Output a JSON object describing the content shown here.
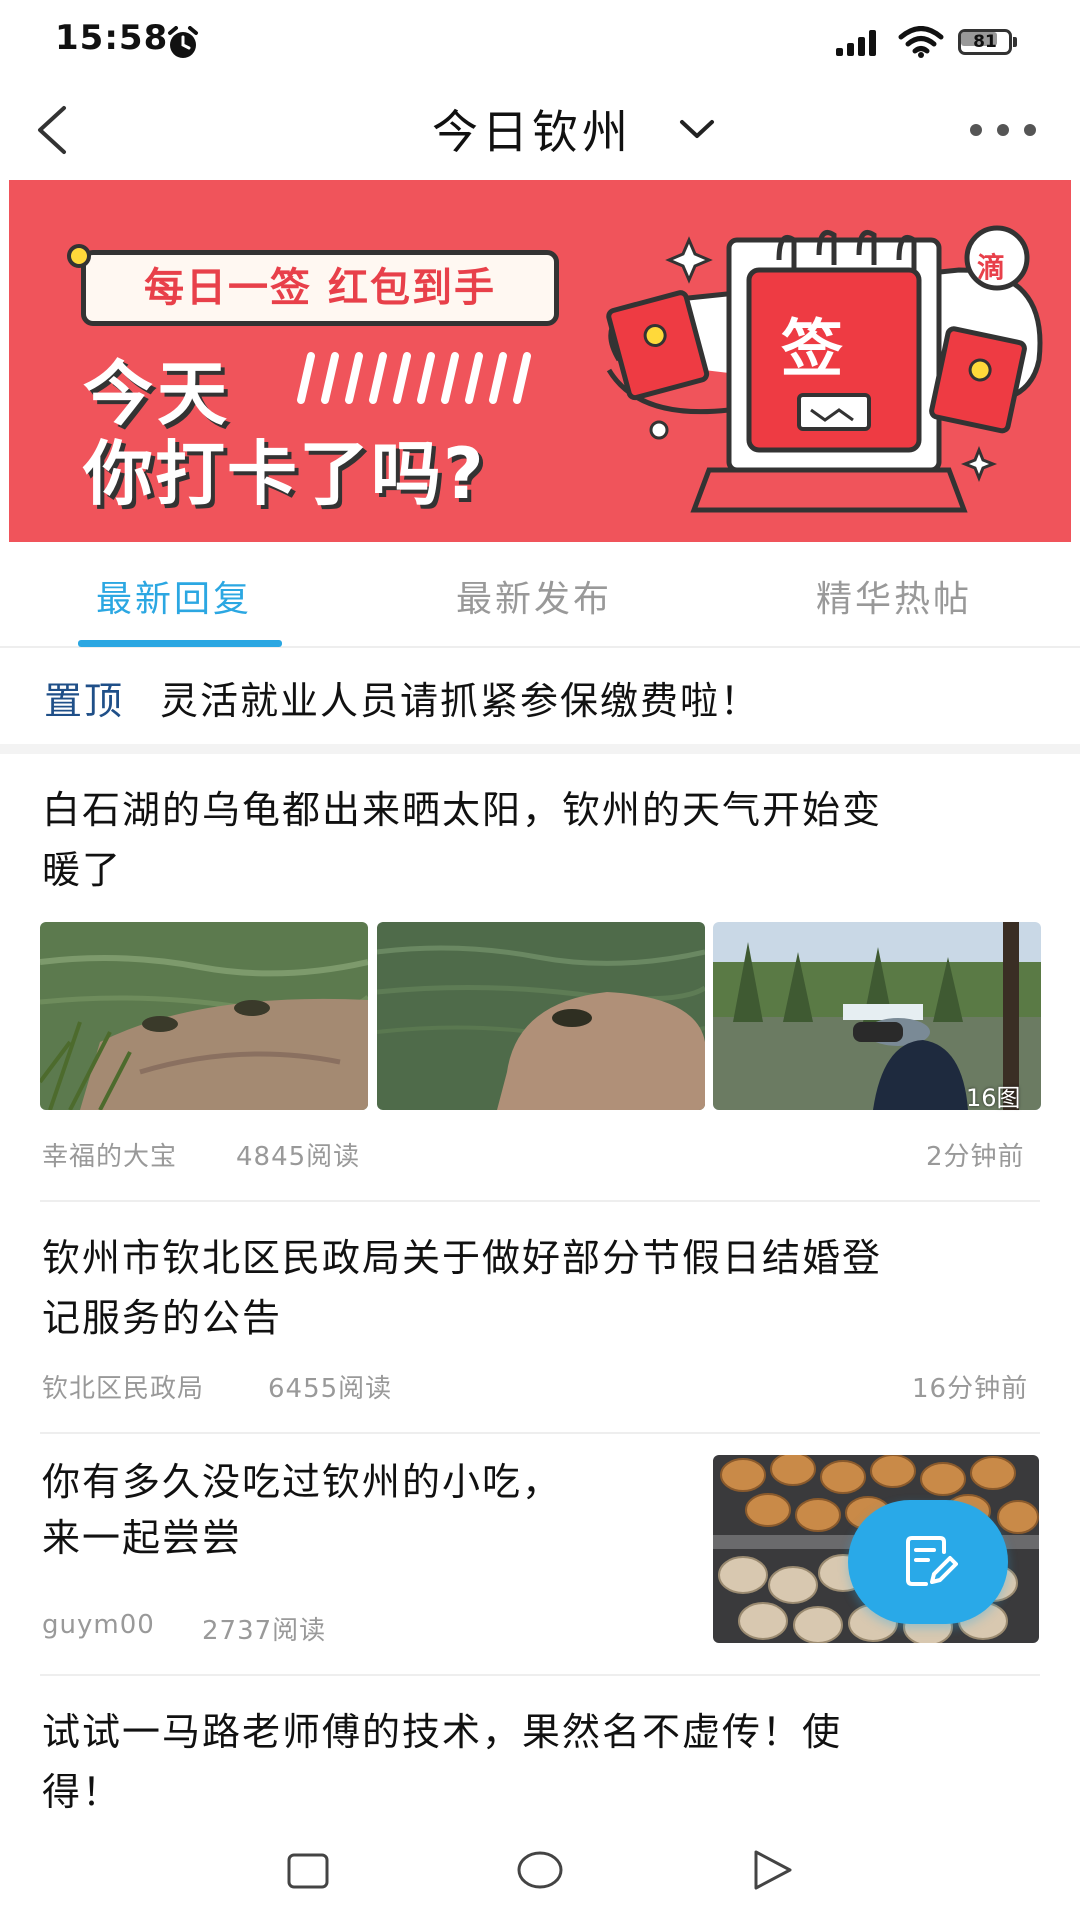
{
  "status_bar": {
    "time": "15:58",
    "battery": "81"
  },
  "header": {
    "title": "今日钦州"
  },
  "banner": {
    "pill_text": "每日一签 红包到手",
    "line1": "今天",
    "line2": "你打卡了吗?",
    "sign_char": "签",
    "badge_char": "滴"
  },
  "tabs": [
    {
      "label": "最新回复"
    },
    {
      "label": "最新发布"
    },
    {
      "label": "精华热帖"
    }
  ],
  "pinned": {
    "tag": "置顶",
    "text": "灵活就业人员请抓紧参保缴费啦！"
  },
  "posts": [
    {
      "title_line1": "白石湖的乌龟都出来晒太阳，钦州的天气开始变",
      "title_line2": "暖了",
      "author": "幸福的大宝",
      "reads": "4845阅读",
      "time": "2分钟前",
      "image_count": "16图"
    },
    {
      "title_line1": "钦州市钦北区民政局关于做好部分节假日结婚登",
      "title_line2": "记服务的公告",
      "author": "钦北区民政局",
      "reads": "6455阅读",
      "time": "16分钟前"
    },
    {
      "title_line1": "你有多久没吃过钦州的小吃，",
      "title_line2": "来一起尝尝",
      "author": "guym00",
      "reads": "2737阅读"
    },
    {
      "title_line1": "试试一马路老师傅的技术，果然名不虚传！使",
      "title_line2": "得！"
    }
  ],
  "colors": {
    "accent": "#2ba7e2",
    "banner_bg": "#f0545b",
    "pinned_tag": "#1f4f88"
  }
}
